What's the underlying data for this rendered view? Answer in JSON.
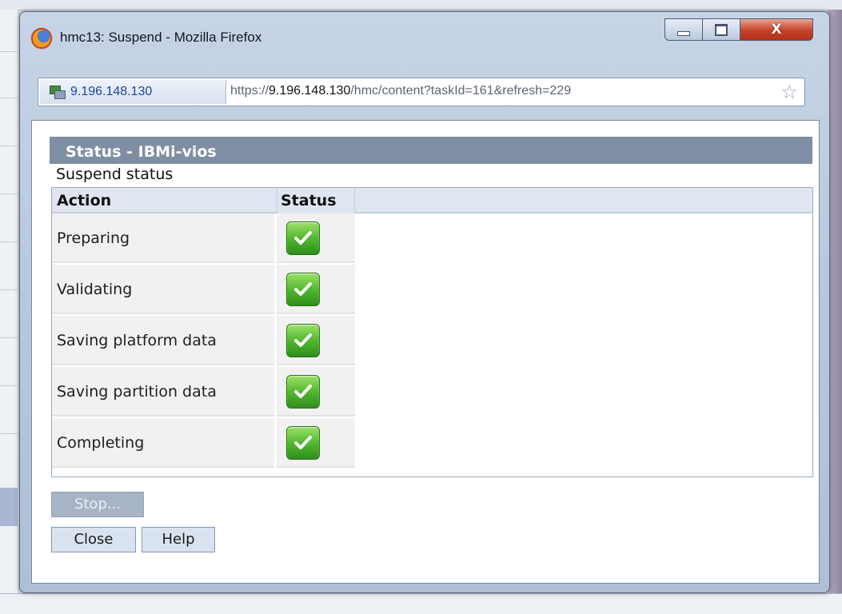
{
  "window": {
    "title": "hmc13: Suspend - Mozilla Firefox",
    "controls": {
      "close": "X"
    }
  },
  "urlbar": {
    "site_identity": "9.196.148.130",
    "url_prefix": "https://",
    "url_host": "9.196.148.130",
    "url_path": "/hmc/content?taskId=161&refresh=229",
    "bookmark_icon": "star-icon"
  },
  "panel": {
    "header": "Status - IBMi-vios",
    "subtitle": "Suspend status"
  },
  "table": {
    "columns": {
      "action": "Action",
      "status": "Status"
    },
    "rows": [
      {
        "action": "Preparing",
        "status": "complete"
      },
      {
        "action": "Validating",
        "status": "complete"
      },
      {
        "action": "Saving platform data",
        "status": "complete"
      },
      {
        "action": "Saving partition data",
        "status": "complete"
      },
      {
        "action": "Completing",
        "status": "complete"
      }
    ]
  },
  "buttons": {
    "stop": "Stop...",
    "close": "Close",
    "help": "Help"
  },
  "colors": {
    "header_bg": "#7f8ea3",
    "check_green": "#52b830"
  }
}
